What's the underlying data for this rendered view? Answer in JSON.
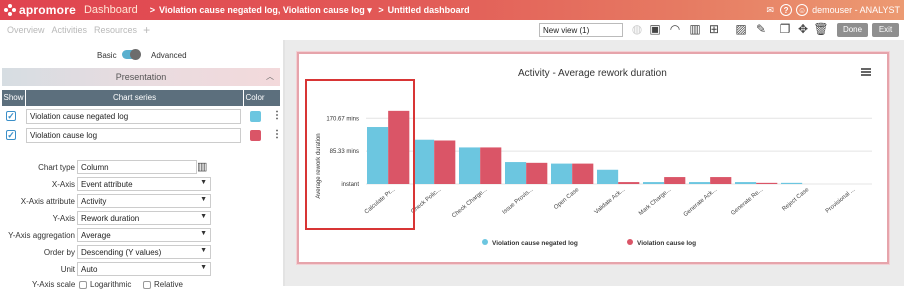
{
  "topbar": {
    "logo": "apromore",
    "app": "Dashboard",
    "breadcrumb_sep": ">",
    "breadcrumb_logs": "Violation cause negated log, Violation cause log",
    "breadcrumb_dashboard": "Untitled dashboard",
    "user": "demouser - ANALYST"
  },
  "menu": {
    "items": [
      "Overview",
      "Activities",
      "Resources"
    ],
    "add": "+"
  },
  "toolbar": {
    "view_select": "New view (1)",
    "done": "Done",
    "exit": "Exit"
  },
  "panel": {
    "mode_basic": "Basic",
    "mode_advanced": "Advanced",
    "presentation": "Presentation",
    "series_headers": {
      "show": "Show",
      "series": "Chart series",
      "color": "Color"
    },
    "series": [
      {
        "name": "Violation cause negated log",
        "color": "#6cc6e0",
        "checked": true
      },
      {
        "name": "Violation cause log",
        "color": "#da5567",
        "checked": true
      }
    ],
    "fields": [
      {
        "label": "Chart type",
        "value": "Column",
        "type": "icon"
      },
      {
        "label": "X-Axis",
        "value": "Event attribute",
        "type": "select"
      },
      {
        "label": "X-Axis attribute",
        "value": "Activity",
        "type": "select"
      },
      {
        "label": "Y-Axis",
        "value": "Rework duration",
        "type": "select"
      },
      {
        "label": "Y-Axis aggregation",
        "value": "Average",
        "type": "select"
      },
      {
        "label": "Order by",
        "value": "Descending (Y values)",
        "type": "select"
      },
      {
        "label": "Unit",
        "value": "Auto",
        "type": "select"
      }
    ],
    "scale_label": "Y-Axis scale",
    "scale_options": [
      "Logarithmic",
      "Relative"
    ]
  },
  "chart_data": {
    "type": "bar",
    "title": "Activity - Average rework duration",
    "ylabel": "Average rework duration",
    "xlabel": "",
    "y_ticks": [
      "instant",
      "85.33 mins",
      "170.67 mins"
    ],
    "ylim": [
      0,
      200
    ],
    "categories": [
      "Calculate Pr...",
      "Check Polic...",
      "Check Charge...",
      "Issue Provis...",
      "Open Case",
      "Validate Ack...",
      "Mark Charge...",
      "Generate Ack...",
      "Generate Re...",
      "Reject Case",
      "Provisional ..."
    ],
    "series": [
      {
        "name": "Violation cause negated log",
        "color": "#6cc6e0",
        "values": [
          148,
          115,
          95,
          57,
          53,
          37,
          5,
          5,
          5,
          3,
          0
        ]
      },
      {
        "name": "Violation cause log",
        "color": "#da5567",
        "values": [
          190,
          113,
          95,
          55,
          53,
          5,
          18,
          18,
          3,
          0,
          0
        ]
      }
    ],
    "legend_position": "bottom"
  }
}
